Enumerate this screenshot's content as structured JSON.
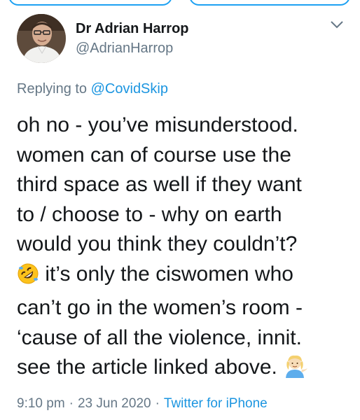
{
  "author": {
    "name": "Dr Adrian Harrop",
    "handle": "@AdrianHarrop"
  },
  "reply": {
    "prefix": "Replying to ",
    "to": "@CovidSkip"
  },
  "tweet": {
    "line1": "oh no - you’ve misunderstood.",
    "line2": "women can of course use the",
    "line3": "third space as well if they want",
    "line4": "to / choose to - why on earth",
    "line5": "would you think they couldn’t?",
    "line6": " it’s only the ciswomen who",
    "line7": "can’t go in the women’s room -",
    "line8": "‘cause of all the violence, innit.",
    "line9": "see the article linked above. ",
    "emoji1": "rolling-on-floor-laughing-emoji",
    "emoji2": "person-tipping-hand-emoji"
  },
  "meta": {
    "time": "9:10 pm",
    "separator": "·",
    "date": "23 Jun 2020",
    "source": "Twitter for iPhone"
  },
  "colors": {
    "accent": "#1da1f2",
    "link": "#1b95e0",
    "muted": "#657786",
    "text": "#14171a"
  }
}
